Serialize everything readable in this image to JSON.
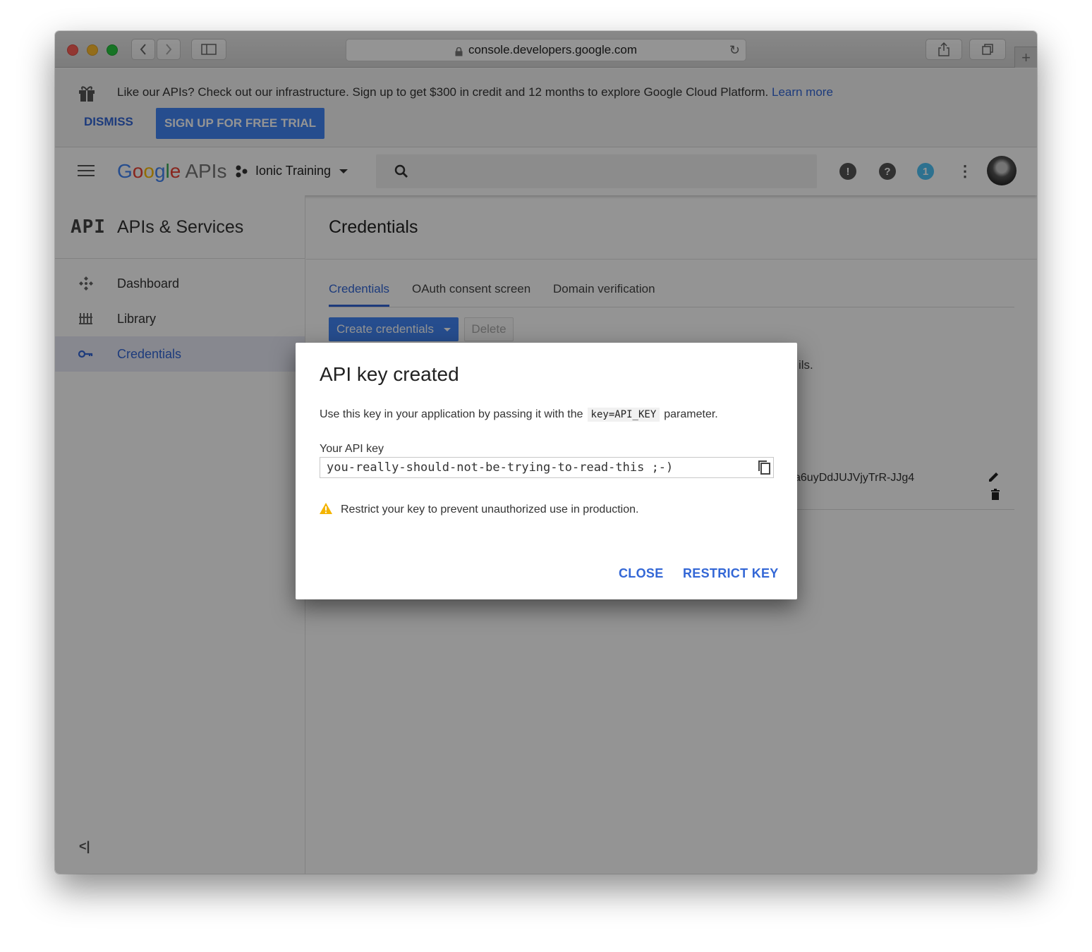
{
  "browser": {
    "url": "console.developers.google.com"
  },
  "banner": {
    "message": "Like our APIs? Check out our infrastructure. Sign up to get $300 in credit and 12 months to explore Google Cloud Platform.",
    "learn_more": "Learn more",
    "dismiss_label": "DISMISS",
    "signup_label": "SIGN UP FOR FREE TRIAL"
  },
  "appbar": {
    "logo_letters": [
      "G",
      "o",
      "o",
      "g",
      "l",
      "e"
    ],
    "logo_suffix": "APIs",
    "project_name": "Ionic Training",
    "notification_count": "1"
  },
  "sidebar": {
    "section_mark": "API",
    "section_title": "APIs & Services",
    "items": [
      {
        "label": "Dashboard"
      },
      {
        "label": "Library"
      },
      {
        "label": "Credentials"
      }
    ],
    "collapse_glyph": "<|"
  },
  "main": {
    "title": "Credentials",
    "tabs": [
      {
        "label": "Credentials"
      },
      {
        "label": "OAuth consent screen"
      },
      {
        "label": "Domain verification"
      }
    ],
    "create_label": "Create credentials",
    "delete_label": "Delete",
    "partial_text": "ils.",
    "partial_key": "a6uyDdJUJVjyTrR-JJg4"
  },
  "dialog": {
    "title": "API key created",
    "body_before": "Use this key in your application by passing it with the",
    "body_code": "key=API_KEY",
    "body_after": "parameter.",
    "field_label": "Your API key",
    "key_value": "you-really-should-not-be-trying-to-read-this ;-)",
    "warning": "Restrict your key to prevent unauthorized use in production.",
    "close_label": "CLOSE",
    "restrict_label": "RESTRICT KEY"
  },
  "colors": {
    "accent": "#3367d6",
    "primary_button": "#4285f4",
    "warning": "#f4b400",
    "notification": "#4fc3f7"
  }
}
